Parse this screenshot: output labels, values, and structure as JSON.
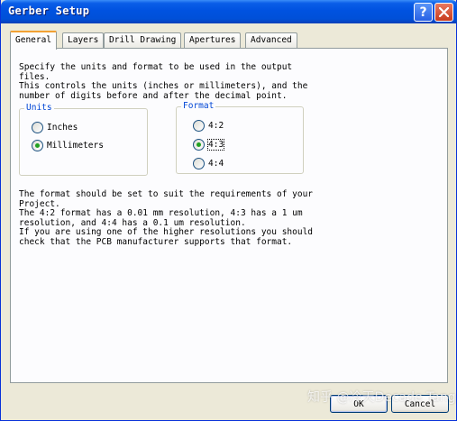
{
  "window": {
    "title": "Gerber Setup",
    "help_label": "?",
    "accent": "#0054e3"
  },
  "tabs": [
    {
      "label": "General",
      "active": true
    },
    {
      "label": "Layers",
      "active": false
    },
    {
      "label": "Drill Drawing",
      "active": false
    },
    {
      "label": "Apertures",
      "active": false
    },
    {
      "label": "Advanced",
      "active": false
    }
  ],
  "intro_text": "Specify the units and format to be used in the output\nfiles.\nThis controls the units (inches or millimeters), and the\nnumber of digits before and after the decimal point.",
  "units": {
    "label": "Units",
    "options": [
      {
        "label": "Inches",
        "checked": false
      },
      {
        "label": "Millimeters",
        "checked": true
      }
    ]
  },
  "format": {
    "label": "Format",
    "options": [
      {
        "label": "4:2",
        "checked": false
      },
      {
        "label": "4:3",
        "checked": true
      },
      {
        "label": "4:4",
        "checked": false
      }
    ]
  },
  "info_text": "The format should be set to suit the requirements of your\nProject.\nThe 4:2 format has a 0.01 mm resolution, 4:3 has a 1 um\nresolution, and 4:4 has a 0.1 um resolution.\nIf you are using one of the higher resolutions you should\ncheck that the PCB manufacturer supports that format.",
  "buttons": {
    "ok": "OK",
    "cancel": "Cancel"
  },
  "watermark": "知乎 @冷天Decade Tang"
}
